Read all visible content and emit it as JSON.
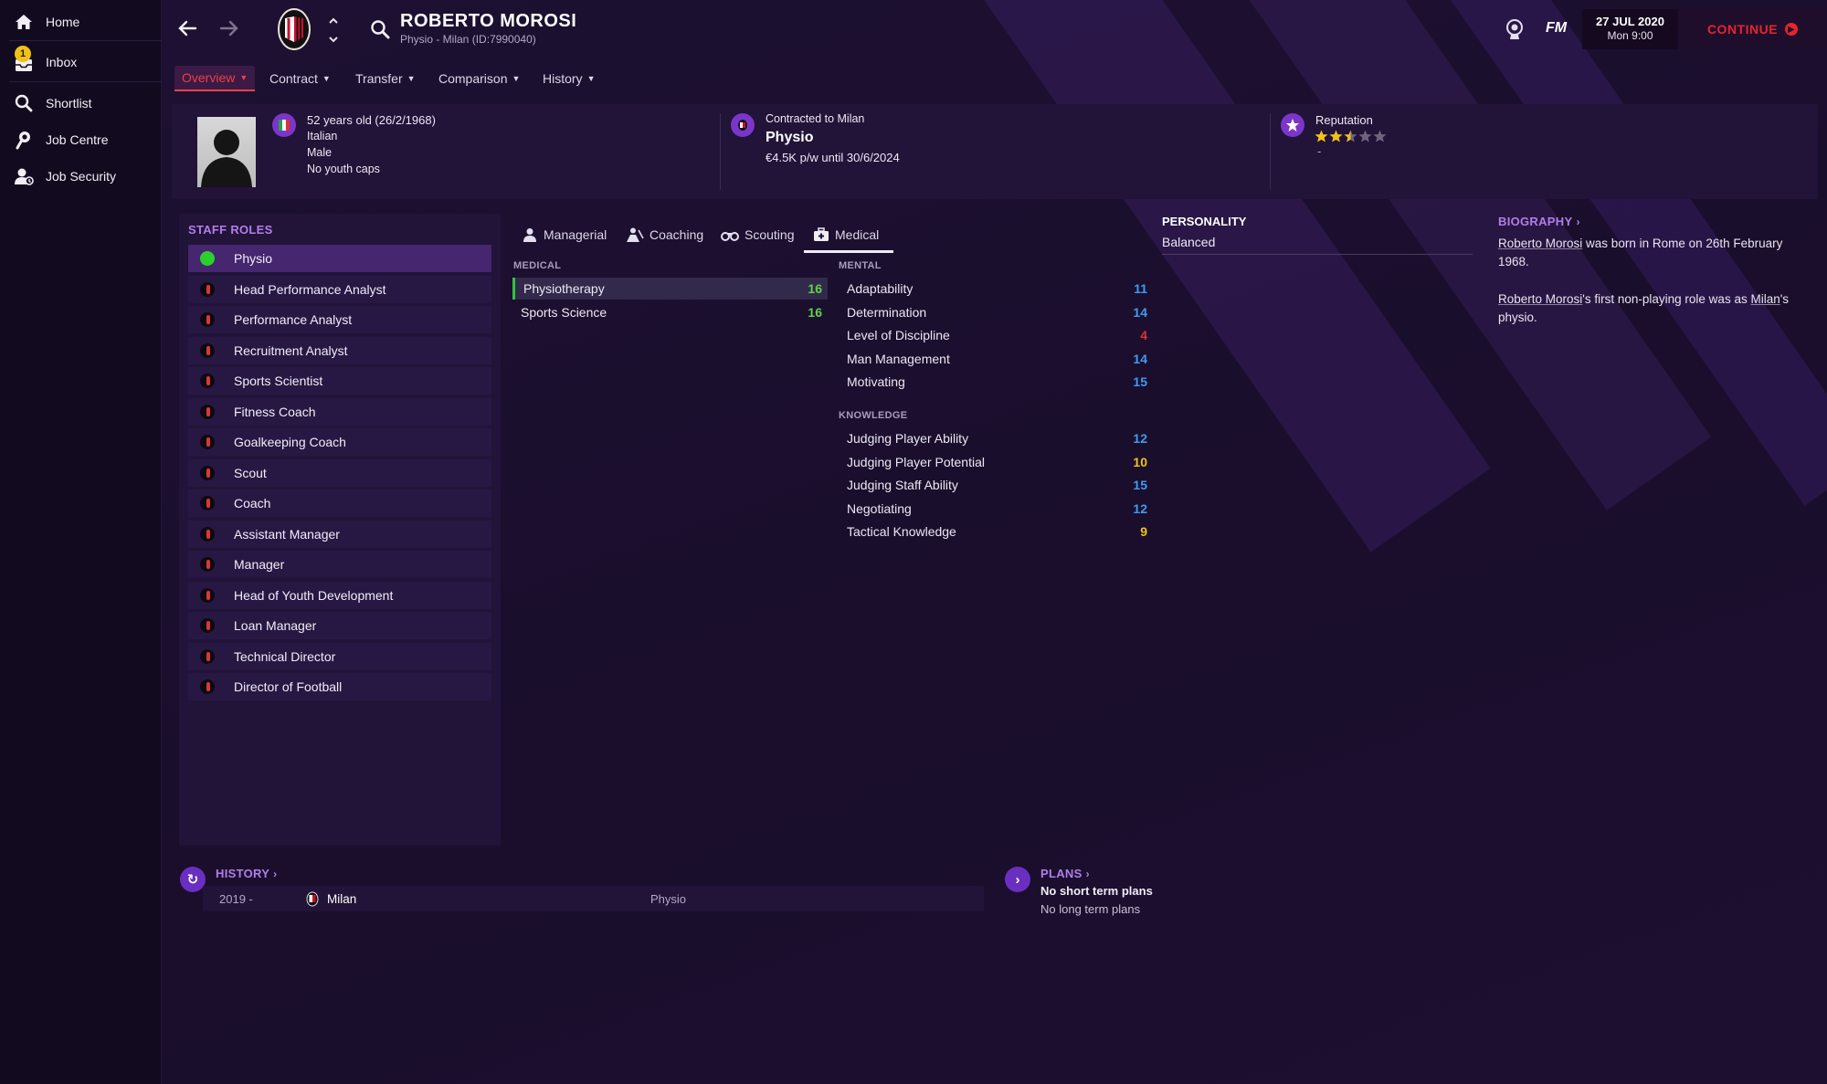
{
  "sidebar": {
    "items": [
      {
        "label": "Home",
        "icon": "home-icon"
      },
      {
        "label": "Inbox",
        "icon": "inbox-icon",
        "badge": "1"
      },
      {
        "label": "Shortlist",
        "icon": "search-icon"
      },
      {
        "label": "Job Centre",
        "icon": "job-centre-icon"
      },
      {
        "label": "Job Security",
        "icon": "job-security-icon"
      }
    ]
  },
  "header": {
    "name": "ROBERTO MOROSI",
    "subtitle": "Physio - Milan (ID:7990040)",
    "fm_label": "FM",
    "date": "27 JUL 2020",
    "time": "Mon 9:00",
    "continue_label": "CONTINUE"
  },
  "tabs": [
    {
      "label": "Overview",
      "active": true
    },
    {
      "label": "Contract"
    },
    {
      "label": "Transfer"
    },
    {
      "label": "Comparison"
    },
    {
      "label": "History"
    }
  ],
  "info": {
    "age": "52 years old (26/2/1968)",
    "nationality": "Italian",
    "gender": "Male",
    "youth_caps": "No youth caps",
    "contract_label": "Contracted to Milan",
    "role": "Physio",
    "wage": "€4.5K p/w until 30/6/2024",
    "reputation_label": "Reputation",
    "reputation_stars": 2.5,
    "reputation_sub": "-"
  },
  "staff_roles": {
    "title": "STAFF ROLES",
    "roles": [
      {
        "label": "Physio",
        "active": true
      },
      {
        "label": "Head Performance Analyst"
      },
      {
        "label": "Performance Analyst"
      },
      {
        "label": "Recruitment Analyst"
      },
      {
        "label": "Sports Scientist"
      },
      {
        "label": "Fitness Coach"
      },
      {
        "label": "Goalkeeping Coach"
      },
      {
        "label": "Scout"
      },
      {
        "label": "Coach"
      },
      {
        "label": "Assistant Manager"
      },
      {
        "label": "Manager"
      },
      {
        "label": "Head of Youth Development"
      },
      {
        "label": "Loan Manager"
      },
      {
        "label": "Technical Director"
      },
      {
        "label": "Director of Football"
      }
    ]
  },
  "attribute_tabs": [
    {
      "label": "Managerial",
      "icon": "managerial-icon"
    },
    {
      "label": "Coaching",
      "icon": "coaching-icon"
    },
    {
      "label": "Scouting",
      "icon": "binoculars-icon"
    },
    {
      "label": "Medical",
      "icon": "medical-kit-icon",
      "active": true
    }
  ],
  "medical": {
    "title": "MEDICAL",
    "rows": [
      {
        "name": "Physiotherapy",
        "value": "16",
        "color": "#5fd34a"
      },
      {
        "name": "Sports Science",
        "value": "16",
        "color": "#5fd34a"
      }
    ]
  },
  "mental": {
    "title": "MENTAL",
    "rows": [
      {
        "name": "Adaptability",
        "value": "11",
        "color": "#3f9bf0"
      },
      {
        "name": "Determination",
        "value": "14",
        "color": "#3f9bf0"
      },
      {
        "name": "Level of Discipline",
        "value": "4",
        "color": "#e6302f"
      },
      {
        "name": "Man Management",
        "value": "14",
        "color": "#3f9bf0"
      },
      {
        "name": "Motivating",
        "value": "15",
        "color": "#3f9bf0"
      }
    ]
  },
  "knowledge": {
    "title": "KNOWLEDGE",
    "rows": [
      {
        "name": "Judging Player Ability",
        "value": "12",
        "color": "#3f9bf0"
      },
      {
        "name": "Judging Player Potential",
        "value": "10",
        "color": "#f0c419"
      },
      {
        "name": "Judging Staff Ability",
        "value": "15",
        "color": "#3f9bf0"
      },
      {
        "name": "Negotiating",
        "value": "12",
        "color": "#3f9bf0"
      },
      {
        "name": "Tactical Knowledge",
        "value": "9",
        "color": "#f0c419"
      }
    ]
  },
  "personality": {
    "title": "PERSONALITY",
    "value": "Balanced"
  },
  "biography": {
    "title": "BIOGRAPHY",
    "p1_name": "Roberto Morosi",
    "p1_rest": " was born in Rome on 26th February 1968.",
    "p2_name": "Roberto Morosi",
    "p2_mid": "'s first non-playing role was as ",
    "p2_club": "Milan",
    "p2_end": "'s physio."
  },
  "history": {
    "title": "HISTORY",
    "rows": [
      {
        "years": "2019 -",
        "club": "Milan",
        "role": "Physio"
      }
    ]
  },
  "plans": {
    "title": "PLANS",
    "short_term": "No short term plans",
    "long_term": "No long term plans"
  },
  "colors": {
    "accent_purple": "#b27ee8",
    "continue_red": "#e6242f",
    "active_role_green": "#2ad12a"
  }
}
